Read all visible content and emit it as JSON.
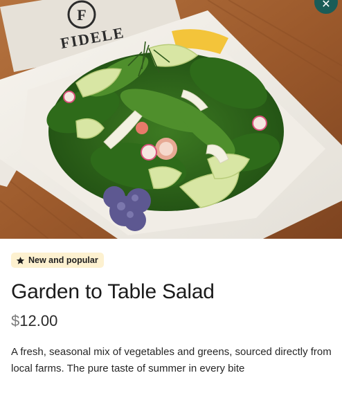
{
  "close_button": {
    "icon": "close-icon",
    "glyph": "✕",
    "color": "#1a5c57"
  },
  "photo": {
    "menu_brand": "FIDELE",
    "menu_monogram": "F"
  },
  "item": {
    "badge": {
      "icon": "star-icon",
      "label": "New and popular",
      "background": "#fdf1d0"
    },
    "name": "Garden to Table Salad",
    "price": {
      "currency": "$",
      "amount": "12.00"
    },
    "description": "A fresh, seasonal mix of vegetables and greens, sourced directly from local farms. The pure taste of summer in every bite"
  }
}
